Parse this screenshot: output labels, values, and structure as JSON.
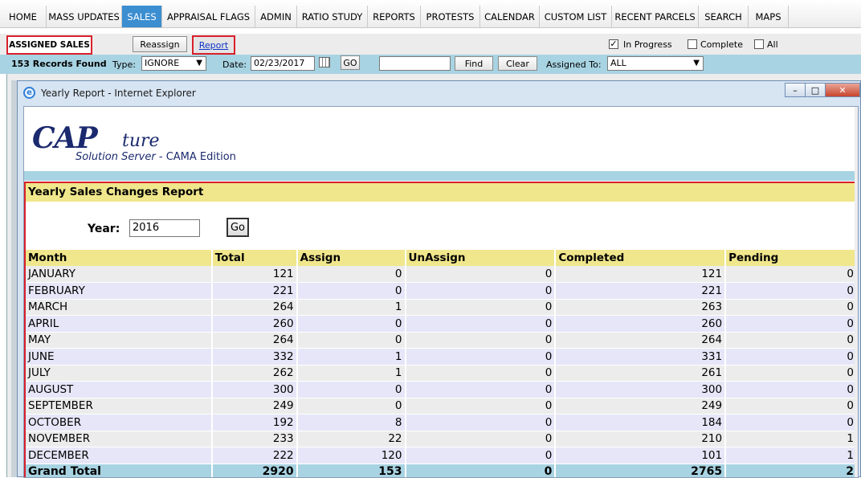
{
  "nav": {
    "items": [
      "HOME",
      "MASS UPDATES",
      "SALES",
      "APPRAISAL FLAGS",
      "ADMIN",
      "RATIO STUDY",
      "REPORTS",
      "PROTESTS",
      "CALENDAR",
      "CUSTOM LIST",
      "RECENT PARCELS",
      "SEARCH",
      "MAPS"
    ],
    "active": "SALES"
  },
  "toolbar": {
    "assigned_label": "ASSIGNED SALES",
    "reassign_label": "Reassign",
    "report_label": "Report",
    "in_progress_label": "In Progress",
    "in_progress_checked": true,
    "complete_label": "Complete",
    "all_label": "All",
    "check_mark": "✓"
  },
  "filter": {
    "records": "153 Records Found",
    "type_label": "Type:",
    "type_value": "IGNORE",
    "date_label": "Date:",
    "date_value": "02/23/2017",
    "go_label": "GO",
    "search_value": "",
    "find_label": "Find",
    "clear_label": "Clear",
    "assigned_to_label": "Assigned To:",
    "assigned_to_value": "ALL"
  },
  "popup": {
    "title": "Yearly Report - Internet Explorer",
    "icon_letter": "e",
    "minimize": "–",
    "restore": "□",
    "close": "✕",
    "logo_main": "CAP",
    "logo_script": "ture",
    "logo_sub_italic": "Solution Server",
    "logo_sub_rest": " - CAMA Edition"
  },
  "report": {
    "title": "Yearly Sales Changes Report",
    "year_label": "Year:",
    "year_value": "2016",
    "go_label": "Go",
    "columns": [
      "Month",
      "Total",
      "Assign",
      "UnAssign",
      "Completed",
      "Pending"
    ],
    "rows": [
      [
        "JANUARY",
        "121",
        "0",
        "0",
        "121",
        "0"
      ],
      [
        "FEBRUARY",
        "221",
        "0",
        "0",
        "221",
        "0"
      ],
      [
        "MARCH",
        "264",
        "1",
        "0",
        "263",
        "0"
      ],
      [
        "APRIL",
        "260",
        "0",
        "0",
        "260",
        "0"
      ],
      [
        "MAY",
        "264",
        "0",
        "0",
        "264",
        "0"
      ],
      [
        "JUNE",
        "332",
        "1",
        "0",
        "331",
        "0"
      ],
      [
        "JULY",
        "262",
        "1",
        "0",
        "261",
        "0"
      ],
      [
        "AUGUST",
        "300",
        "0",
        "0",
        "300",
        "0"
      ],
      [
        "SEPTEMBER",
        "249",
        "0",
        "0",
        "249",
        "0"
      ],
      [
        "OCTOBER",
        "192",
        "8",
        "0",
        "184",
        "0"
      ],
      [
        "NOVEMBER",
        "233",
        "22",
        "0",
        "210",
        "1"
      ],
      [
        "DECEMBER",
        "222",
        "120",
        "0",
        "101",
        "1"
      ]
    ],
    "total_row": [
      "Grand Total",
      "2920",
      "153",
      "0",
      "2765",
      "2"
    ]
  }
}
